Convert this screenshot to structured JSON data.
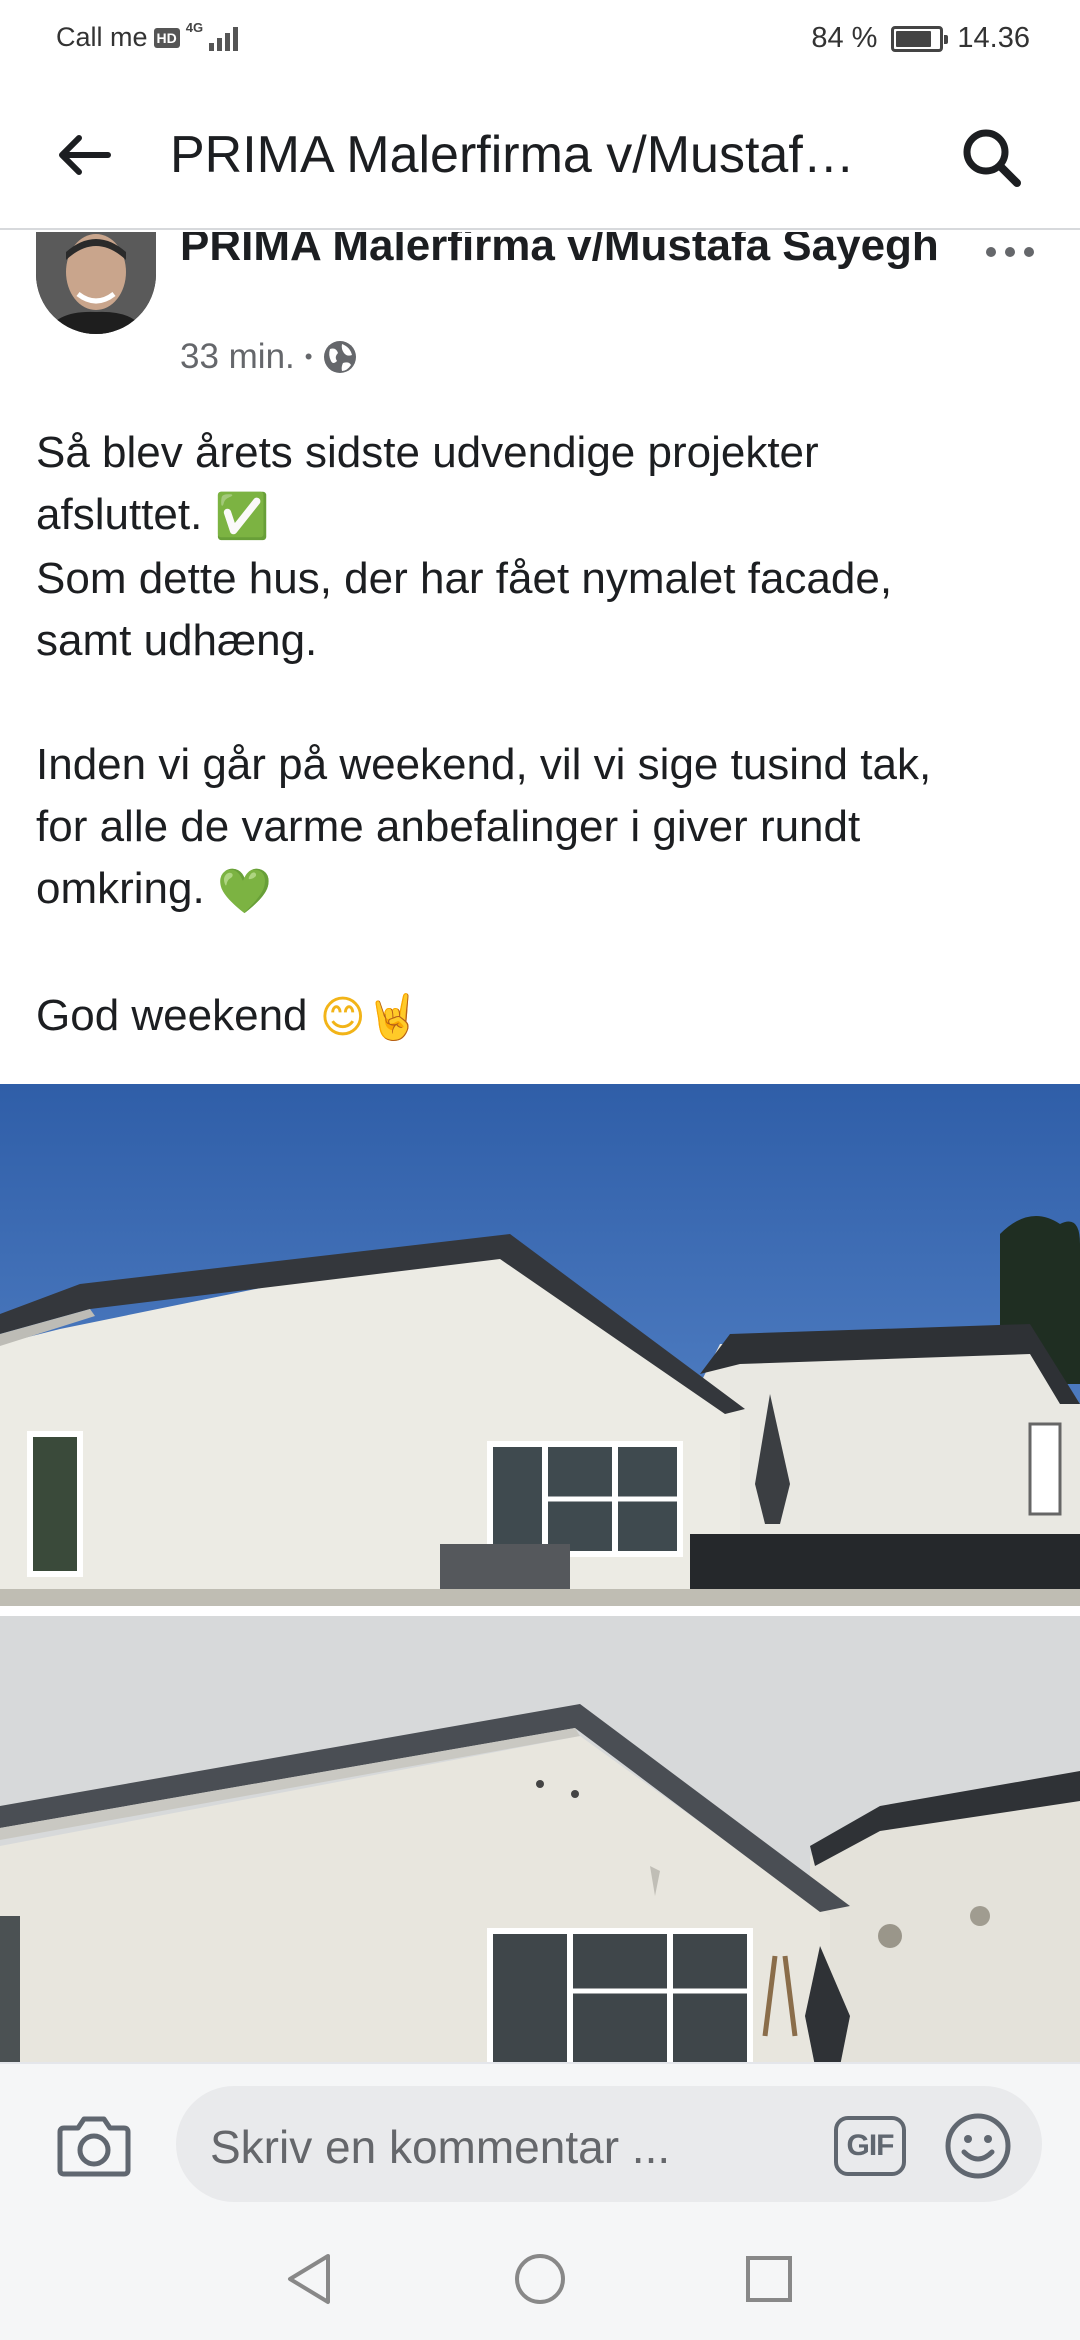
{
  "status_bar": {
    "carrier": "Call me",
    "hd_badge": "HD",
    "network_type": "4G",
    "battery_percent": "84 %",
    "battery_level": 0.84,
    "time": "14.36"
  },
  "header": {
    "title": "PRIMA Malerfirma v/Mustafa Sayegh",
    "back_icon": "arrow-left-icon",
    "search_icon": "search-icon"
  },
  "post": {
    "author": "PRIMA Malerfirma v/Mustafa Sayegh",
    "time_ago": "33 min.",
    "separator": "•",
    "privacy_icon": "globe-icon",
    "more_icon": "more-dots-icon",
    "paragraphs": {
      "p1_line1": "Så blev årets sidste udvendige projekter",
      "p1_line2": "afsluttet.",
      "p1_emoji": "✅",
      "p1_line3": "Som dette hus, der har fået nymalet facade,",
      "p1_line4": "samt udhæng.",
      "p2_line1": "Inden vi går på weekend, vil vi sige tusind tak,",
      "p2_line2": "for alle de varme anbefalinger i giver rundt",
      "p2_line3": "omkring.",
      "p2_emoji": "💚",
      "p3_line1": "God weekend",
      "p3_emoji1": "😊",
      "p3_emoji2": "🤘"
    },
    "photos": [
      "house-after-photo",
      "house-before-photo"
    ]
  },
  "comment_bar": {
    "placeholder": "Skriv en kommentar ...",
    "gif_label": "GIF",
    "camera_icon": "camera-icon",
    "emoji_icon": "smiley-icon"
  },
  "nav_bar": {
    "back_icon": "nav-back-icon",
    "home_icon": "nav-home-icon",
    "recents_icon": "nav-recents-icon"
  },
  "colors": {
    "text_primary": "#1c1e21",
    "text_secondary": "#65676b",
    "sky_top": "#2f5ea8",
    "wall": "#e9e8e2",
    "roof": "#3a3d42"
  }
}
